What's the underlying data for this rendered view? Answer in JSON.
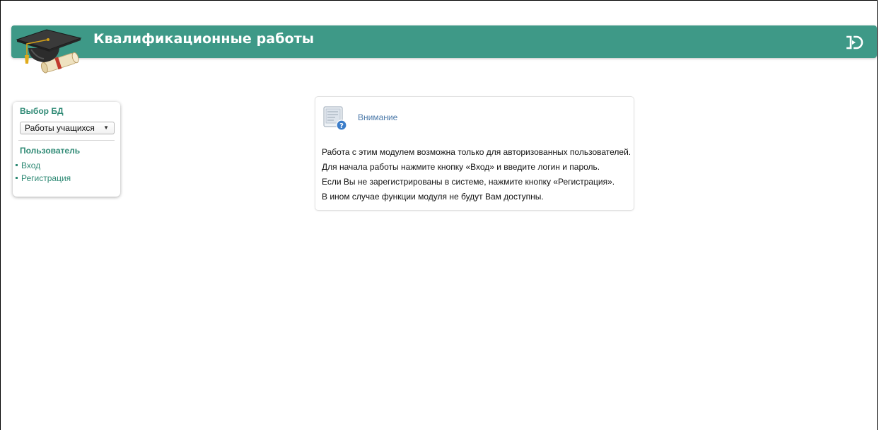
{
  "header": {
    "title": "Квалификационные работы",
    "color": "#3e9987",
    "logo_icon": "graduation-cap-diploma-icon",
    "exit_icon": "exit-logout-icon"
  },
  "sidebar": {
    "db_heading": "Выбор БД",
    "db_select": {
      "selected": "Работы учащихся"
    },
    "user_heading": "Пользователь",
    "links": [
      {
        "label": "Вход"
      },
      {
        "label": "Регистрация"
      }
    ],
    "accent_color": "#2f8a75"
  },
  "notice": {
    "icon": "document-help-icon",
    "title": "Внимание",
    "lines": [
      "Работа с этим модулем возможна только для авторизованных пользователей.",
      "Для начала работы нажмите кнопку «Вход» и введите логин и пароль.",
      "Если Вы не зарегистрированы в системе, нажмите кнопку «Регистрация».",
      "В ином случае функции модуля не будут Вам доступны."
    ]
  }
}
